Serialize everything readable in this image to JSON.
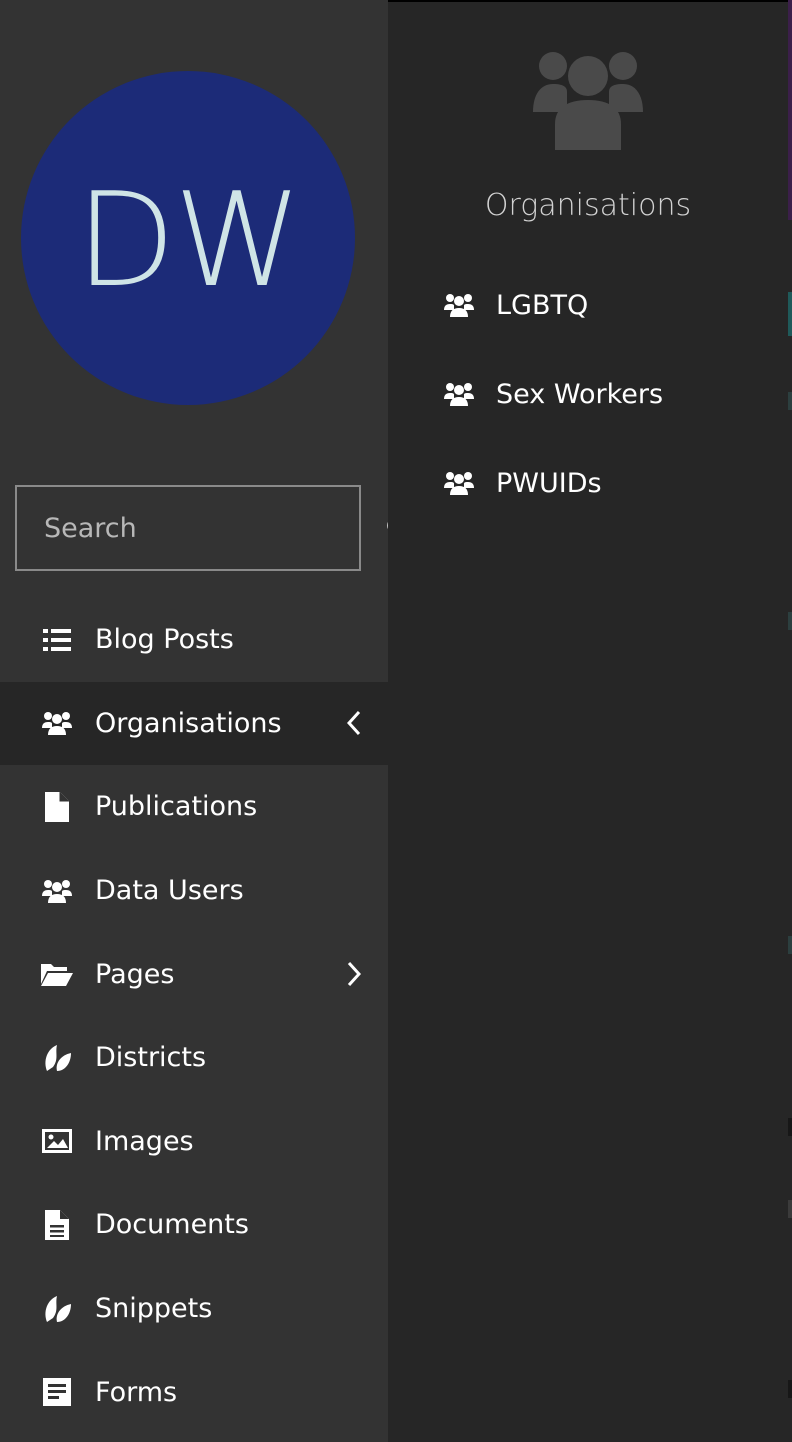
{
  "user": {
    "initials": "DW",
    "avatar_color": "#1c2b78",
    "initials_color": "#cfe4e6"
  },
  "search": {
    "placeholder": "Search",
    "value": ""
  },
  "menu": {
    "items": [
      {
        "label": "Blog Posts",
        "icon": "list-icon",
        "active": false
      },
      {
        "label": "Organisations",
        "icon": "users-icon",
        "active": true,
        "chevron": "chevron-left-icon"
      },
      {
        "label": "Publications",
        "icon": "file-icon",
        "active": false
      },
      {
        "label": "Data Users",
        "icon": "users-icon",
        "active": false
      },
      {
        "label": "Pages",
        "icon": "folder-open-icon",
        "active": false,
        "chevron": "chevron-right-icon"
      },
      {
        "label": "Districts",
        "icon": "leaf-icon",
        "active": false
      },
      {
        "label": "Images",
        "icon": "image-icon",
        "active": false
      },
      {
        "label": "Documents",
        "icon": "document-icon",
        "active": false
      },
      {
        "label": "Snippets",
        "icon": "leaf-icon",
        "active": false
      },
      {
        "label": "Forms",
        "icon": "form-icon",
        "active": false
      }
    ]
  },
  "submenu": {
    "title": "Organisations",
    "icon": "users-icon",
    "items": [
      {
        "label": "LGBTQ",
        "icon": "users-icon"
      },
      {
        "label": "Sex Workers",
        "icon": "users-icon"
      },
      {
        "label": "PWUIDs",
        "icon": "users-icon"
      }
    ]
  },
  "colors": {
    "sidebar_bg": "#333333",
    "panel_bg": "#262626",
    "text": "#ffffff"
  }
}
